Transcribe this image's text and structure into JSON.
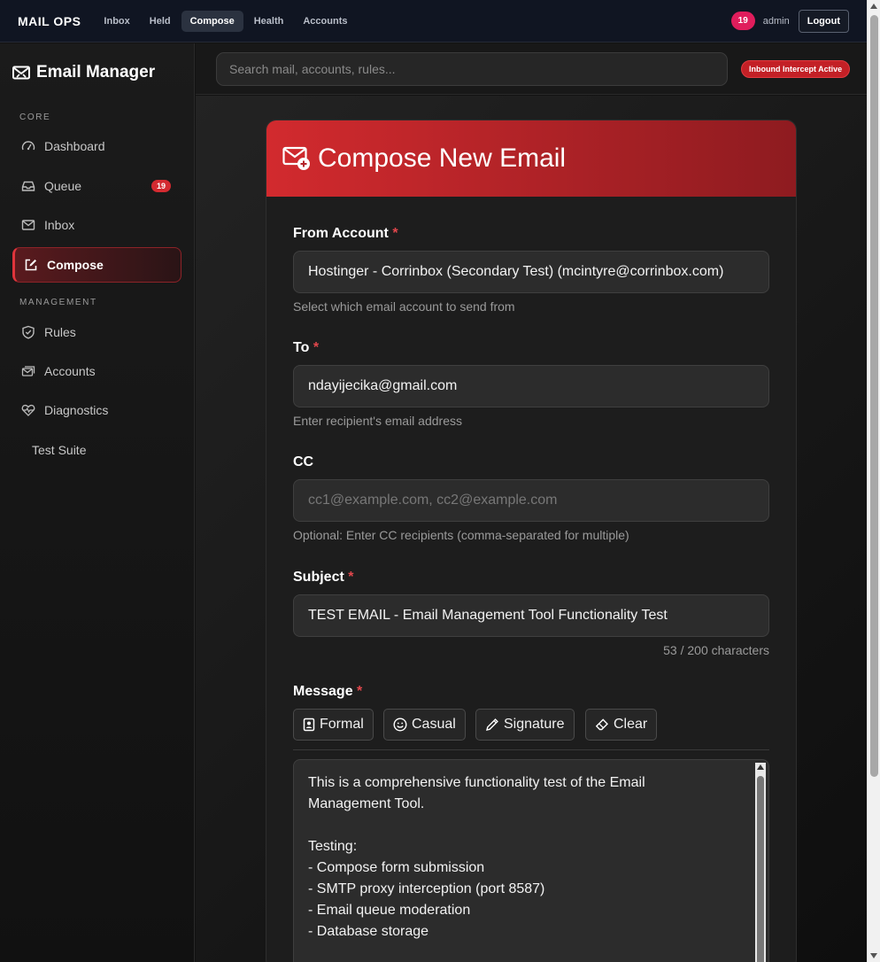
{
  "topnav": {
    "brand": "MAIL OPS",
    "links": [
      "Inbox",
      "Held",
      "Compose",
      "Health",
      "Accounts"
    ],
    "active_link": "Compose",
    "count_badge": "19",
    "user": "admin",
    "logout_label": "Logout"
  },
  "sidebar": {
    "title": "Email Manager",
    "sections": {
      "core": "CORE",
      "management": "MANAGEMENT"
    },
    "items": [
      {
        "label": "Dashboard",
        "icon": "gauge-icon"
      },
      {
        "label": "Queue",
        "icon": "inbox-tray-icon",
        "badge": "19"
      },
      {
        "label": "Inbox",
        "icon": "envelope-icon"
      },
      {
        "label": "Compose",
        "icon": "pencil-square-icon",
        "active": true
      },
      {
        "label": "Rules",
        "icon": "shield-check-icon"
      },
      {
        "label": "Accounts",
        "icon": "envelopes-icon"
      },
      {
        "label": "Diagnostics",
        "icon": "heart-pulse-icon"
      },
      {
        "label": "Test Suite",
        "icon": ""
      }
    ]
  },
  "search": {
    "placeholder": "Search mail, accounts, rules..."
  },
  "status_badge": "Inbound Intercept Active",
  "compose": {
    "title": "Compose New Email",
    "from": {
      "label": "From Account",
      "value": "Hostinger - Corrinbox (Secondary Test) (mcintyre@corrinbox.com)",
      "help": "Select which email account to send from"
    },
    "to": {
      "label": "To",
      "value": "ndayijecika@gmail.com",
      "help": "Enter recipient's email address"
    },
    "cc": {
      "label": "CC",
      "placeholder": "cc1@example.com, cc2@example.com",
      "help": "Optional: Enter CC recipients (comma-separated for multiple)"
    },
    "subject": {
      "label": "Subject",
      "value": "TEST EMAIL - Email Management Tool Functionality Test",
      "counter": "53 / 200 characters"
    },
    "message": {
      "label": "Message",
      "toolbar": [
        "Formal",
        "Casual",
        "Signature",
        "Clear"
      ],
      "lines": [
        "This is a comprehensive functionality test of the Email",
        "Management Tool.",
        "",
        "Testing:",
        "- Compose form submission",
        "- SMTP proxy interception (port 8587)",
        "- Email queue moderation",
        "- Database storage"
      ]
    },
    "required_mark": "*"
  },
  "colors": {
    "accent": "#d22a2e",
    "badge_pink": "#e01d5c"
  }
}
